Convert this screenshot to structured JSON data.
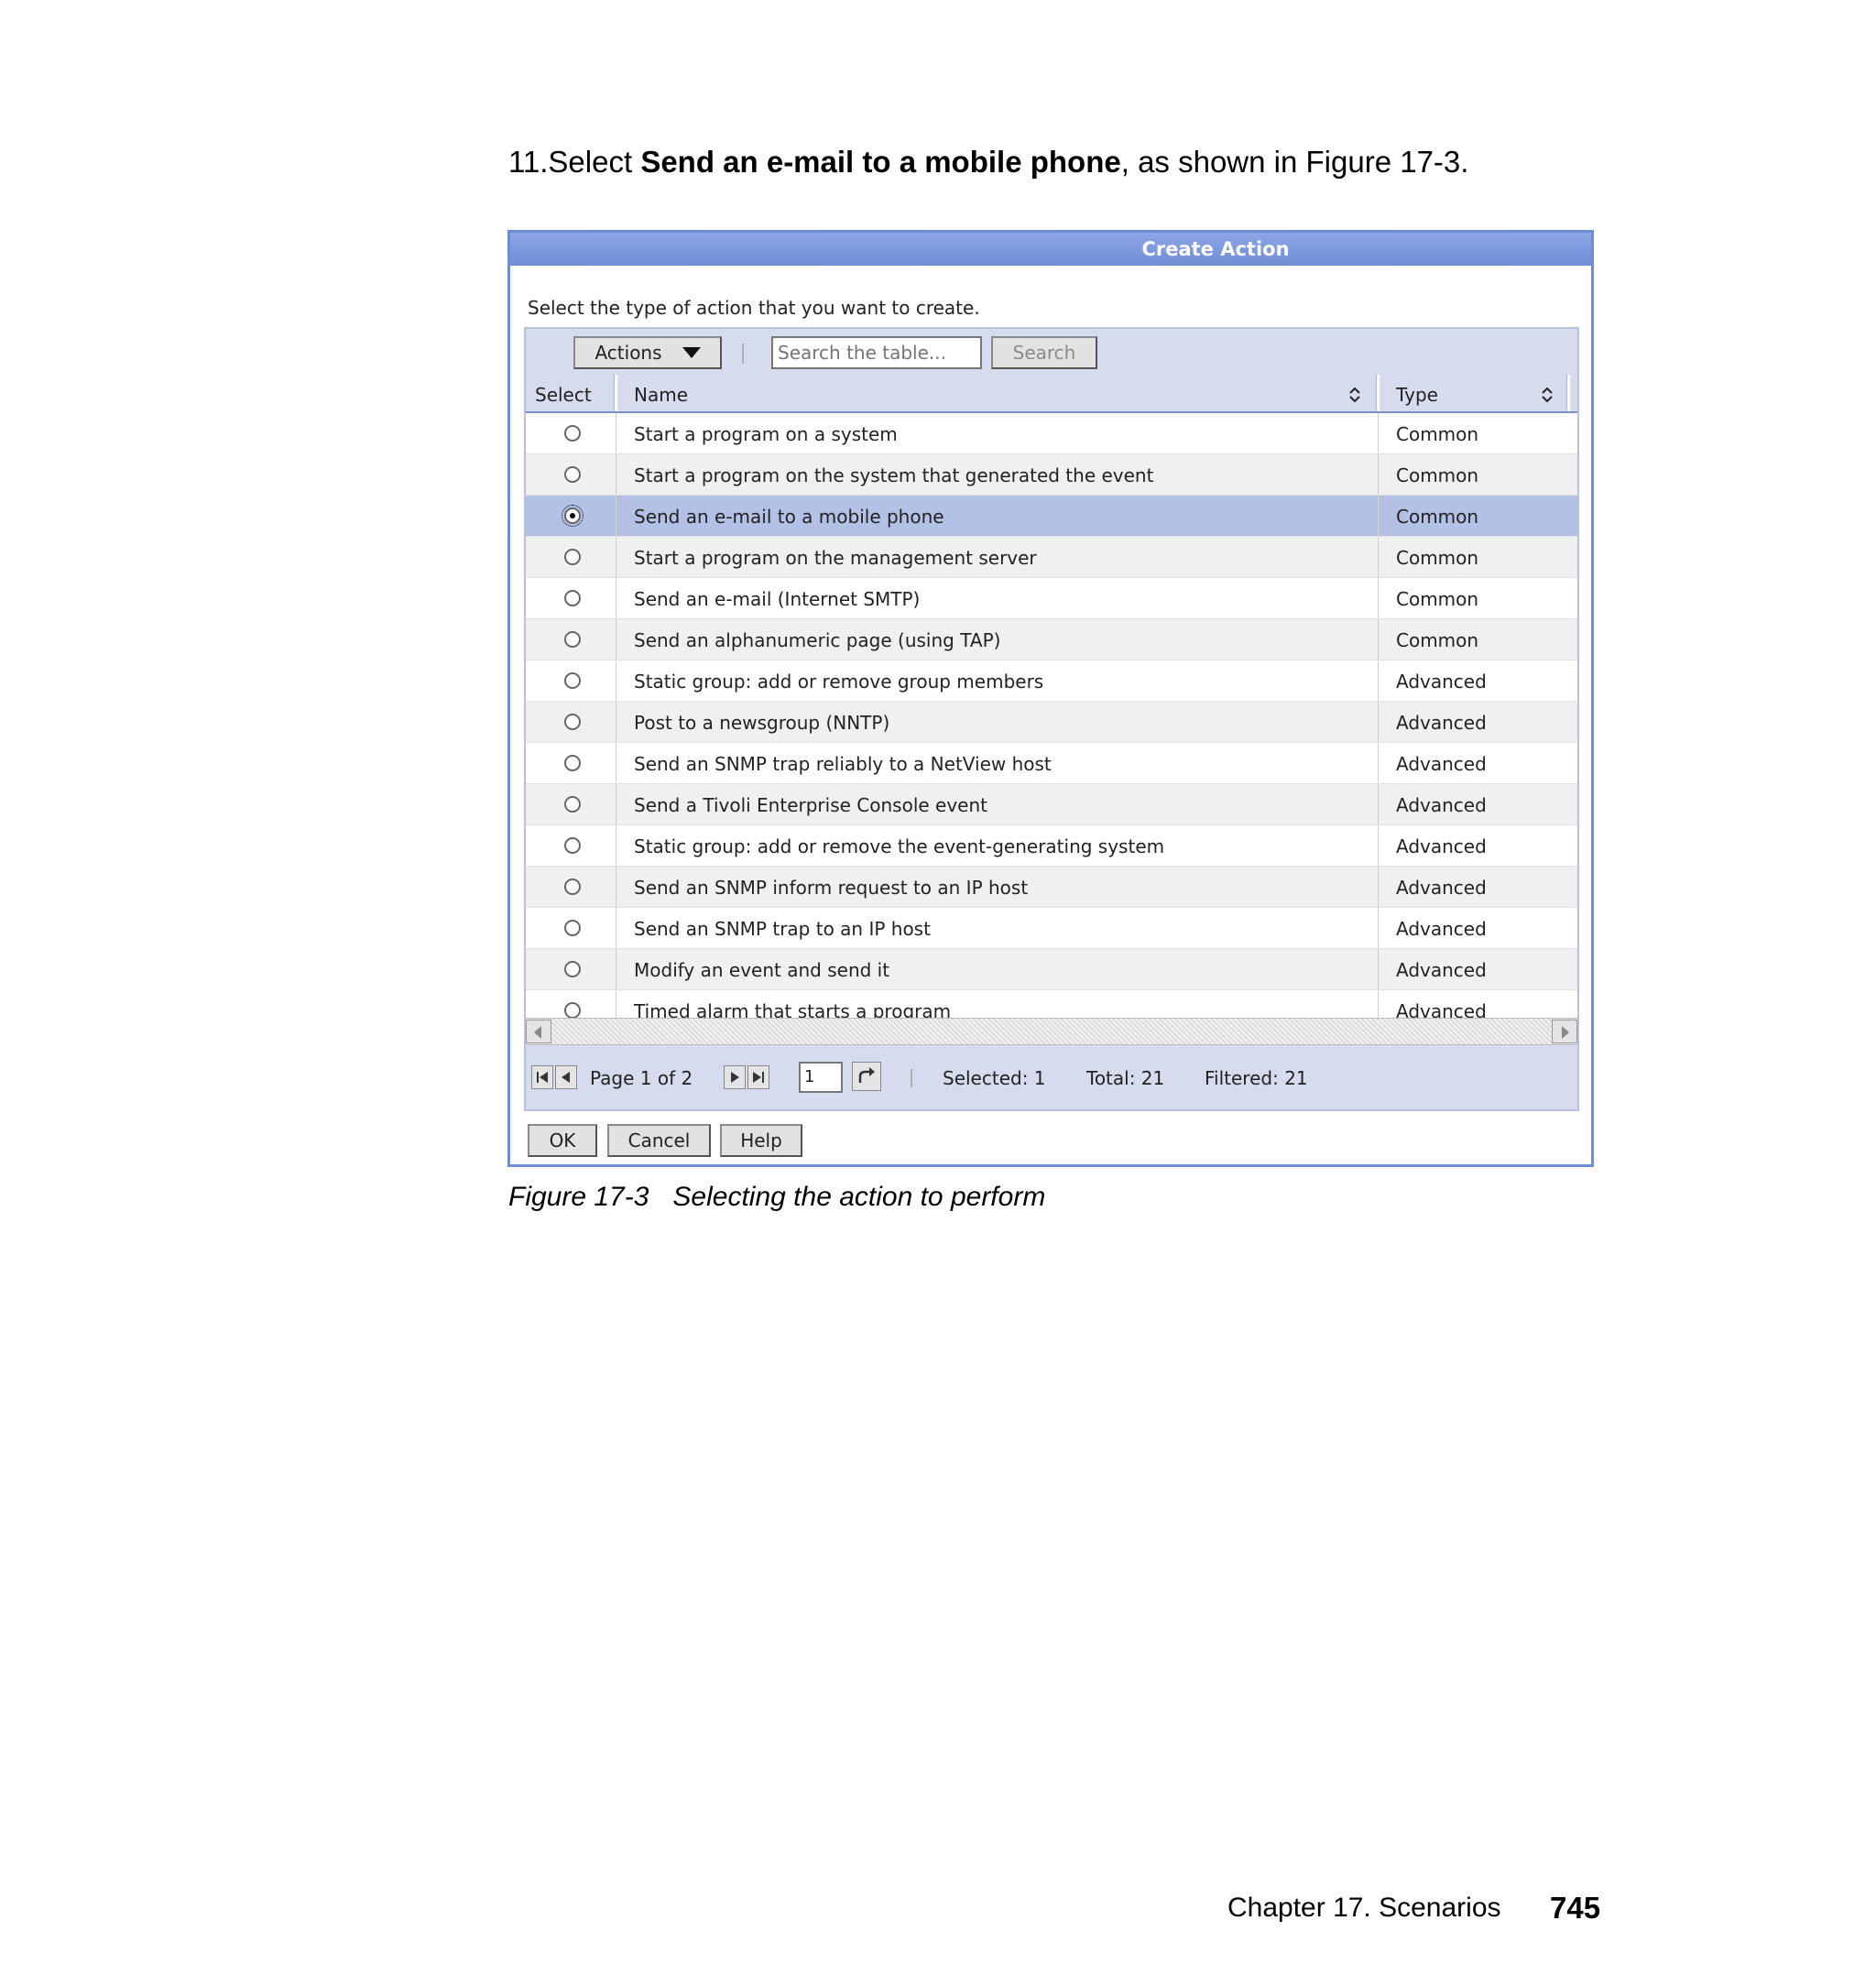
{
  "instruction": {
    "prefix": "11.Select ",
    "bold": "Send an e-mail to a mobile phone",
    "suffix": ", as shown in Figure 17-3."
  },
  "dialog": {
    "title": "Create Action",
    "prompt": "Select the type of action that you want to create.",
    "toolbar": {
      "actions_label": "Actions",
      "search_placeholder": "Search the table...",
      "search_label": "Search"
    },
    "columns": {
      "select": "Select",
      "name": "Name",
      "type": "Type"
    },
    "rows": [
      {
        "name": "Start a program on a system",
        "type": "Common",
        "selected": false
      },
      {
        "name": "Start a program on the system that generated the event",
        "type": "Common",
        "selected": false
      },
      {
        "name": "Send an e-mail to a mobile phone",
        "type": "Common",
        "selected": true
      },
      {
        "name": "Start a program on the management server",
        "type": "Common",
        "selected": false
      },
      {
        "name": "Send an e-mail (Internet SMTP)",
        "type": "Common",
        "selected": false
      },
      {
        "name": "Send an alphanumeric page (using TAP)",
        "type": "Common",
        "selected": false
      },
      {
        "name": "Static group: add or remove group members",
        "type": "Advanced",
        "selected": false
      },
      {
        "name": "Post to a newsgroup (NNTP)",
        "type": "Advanced",
        "selected": false
      },
      {
        "name": "Send an SNMP trap reliably to a NetView host",
        "type": "Advanced",
        "selected": false
      },
      {
        "name": "Send a Tivoli Enterprise Console event",
        "type": "Advanced",
        "selected": false
      },
      {
        "name": "Static group: add or remove the event-generating system",
        "type": "Advanced",
        "selected": false
      },
      {
        "name": "Send an SNMP inform request to an IP host",
        "type": "Advanced",
        "selected": false
      },
      {
        "name": "Send an SNMP trap to an IP host",
        "type": "Advanced",
        "selected": false
      },
      {
        "name": "Modify an event and send it",
        "type": "Advanced",
        "selected": false
      },
      {
        "name": "Timed alarm that starts a program",
        "type": "Advanced",
        "selected": false
      }
    ],
    "pager": {
      "page_text": "Page 1 of 2",
      "page_input": "1",
      "selected": "Selected: 1",
      "total": "Total: 21",
      "filtered": "Filtered: 21"
    },
    "buttons": {
      "ok": "OK",
      "cancel": "Cancel",
      "help": "Help"
    },
    "colors": {
      "title_bar": "#6f8cd6",
      "selected_row": "#b3c1e6",
      "table_bg": "#d6dbee"
    }
  },
  "caption": {
    "number": "Figure 17-3",
    "text": "Selecting the action to perform"
  },
  "footer": {
    "chapter": "Chapter 17. Scenarios",
    "page_number": "745"
  }
}
